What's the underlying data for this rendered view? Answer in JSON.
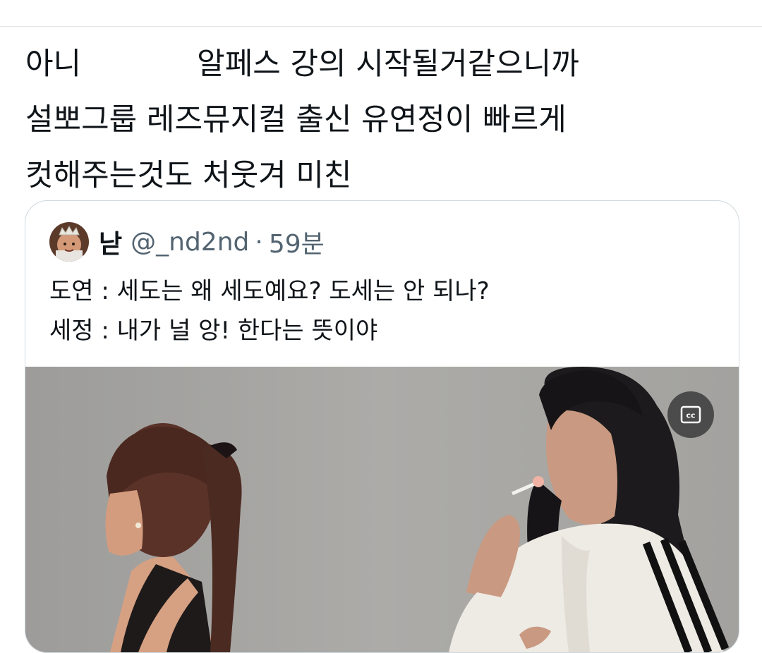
{
  "tweet": {
    "lines": [
      "아니            알페스 강의 시작될거같으니까",
      "설뽀그룹 레즈뮤지컬 출신 유연정이 빠르게",
      "컷해주는것도 처웃겨 미친"
    ]
  },
  "quote": {
    "display_name": "낟",
    "handle": "@_nd2nd",
    "separator": "·",
    "time": "59분",
    "avatar_icon": "avatar-photo-icon",
    "lines": [
      "도연 : 세도는 왜 세도예요? 도세는 안 되나?",
      "세정 : 내가 널 앙! 한다는 뜻이야"
    ],
    "media": {
      "cc_icon": "closed-captions-icon"
    }
  },
  "colors": {
    "text": "#0f1419",
    "secondary": "#536471",
    "border": "#cfd9de",
    "media_bg": "#a6a6a4"
  }
}
